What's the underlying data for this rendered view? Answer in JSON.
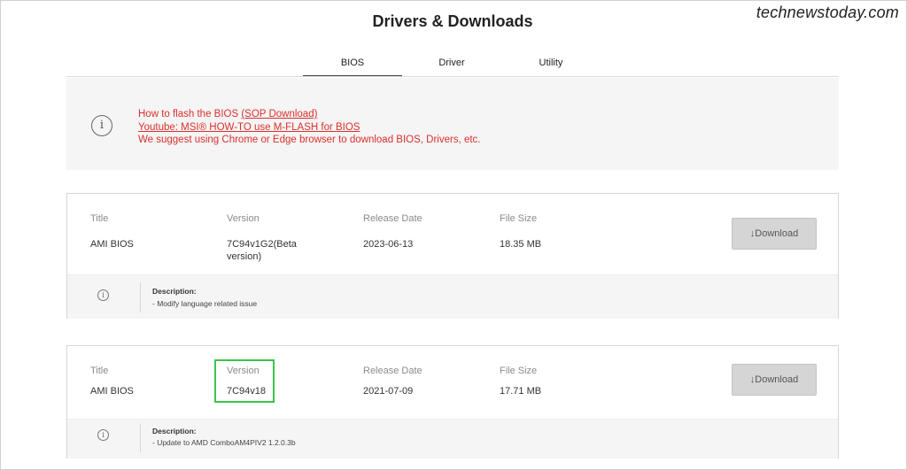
{
  "page": {
    "title": "Drivers & Downloads",
    "watermark": "technewstoday.com"
  },
  "tabs": [
    {
      "label": "BIOS",
      "active": true
    },
    {
      "label": "Driver",
      "active": false
    },
    {
      "label": "Utility",
      "active": false
    }
  ],
  "notice": {
    "icon": "info-circle-icon",
    "line1_prefix": "How to flash the BIOS ",
    "line1_link": "(SOP Download)",
    "line2_link": "Youtube: MSI® HOW-TO use M-FLASH for BIOS",
    "line3": "We suggest using Chrome or Edge browser to download BIOS, Drivers, etc.",
    "color": "#d9302c"
  },
  "columns": {
    "title": "Title",
    "version": "Version",
    "release_date": "Release Date",
    "file_size": "File Size"
  },
  "download_label": "↓Download",
  "entries": [
    {
      "title": "AMI BIOS",
      "version": "7C94v1G2(Beta version)",
      "release_date": "2023-06-13",
      "file_size": "18.35 MB",
      "description_label": "Description:",
      "description": "- Modify language related issue"
    },
    {
      "title": "AMI BIOS",
      "version": "7C94v18",
      "release_date": "2021-07-09",
      "file_size": "17.71 MB",
      "description_label": "Description:",
      "description": "- Update to AMD ComboAM4PIV2 1.2.0.3b",
      "highlighted_field": "version",
      "highlight_color": "#3bc44b"
    }
  ]
}
